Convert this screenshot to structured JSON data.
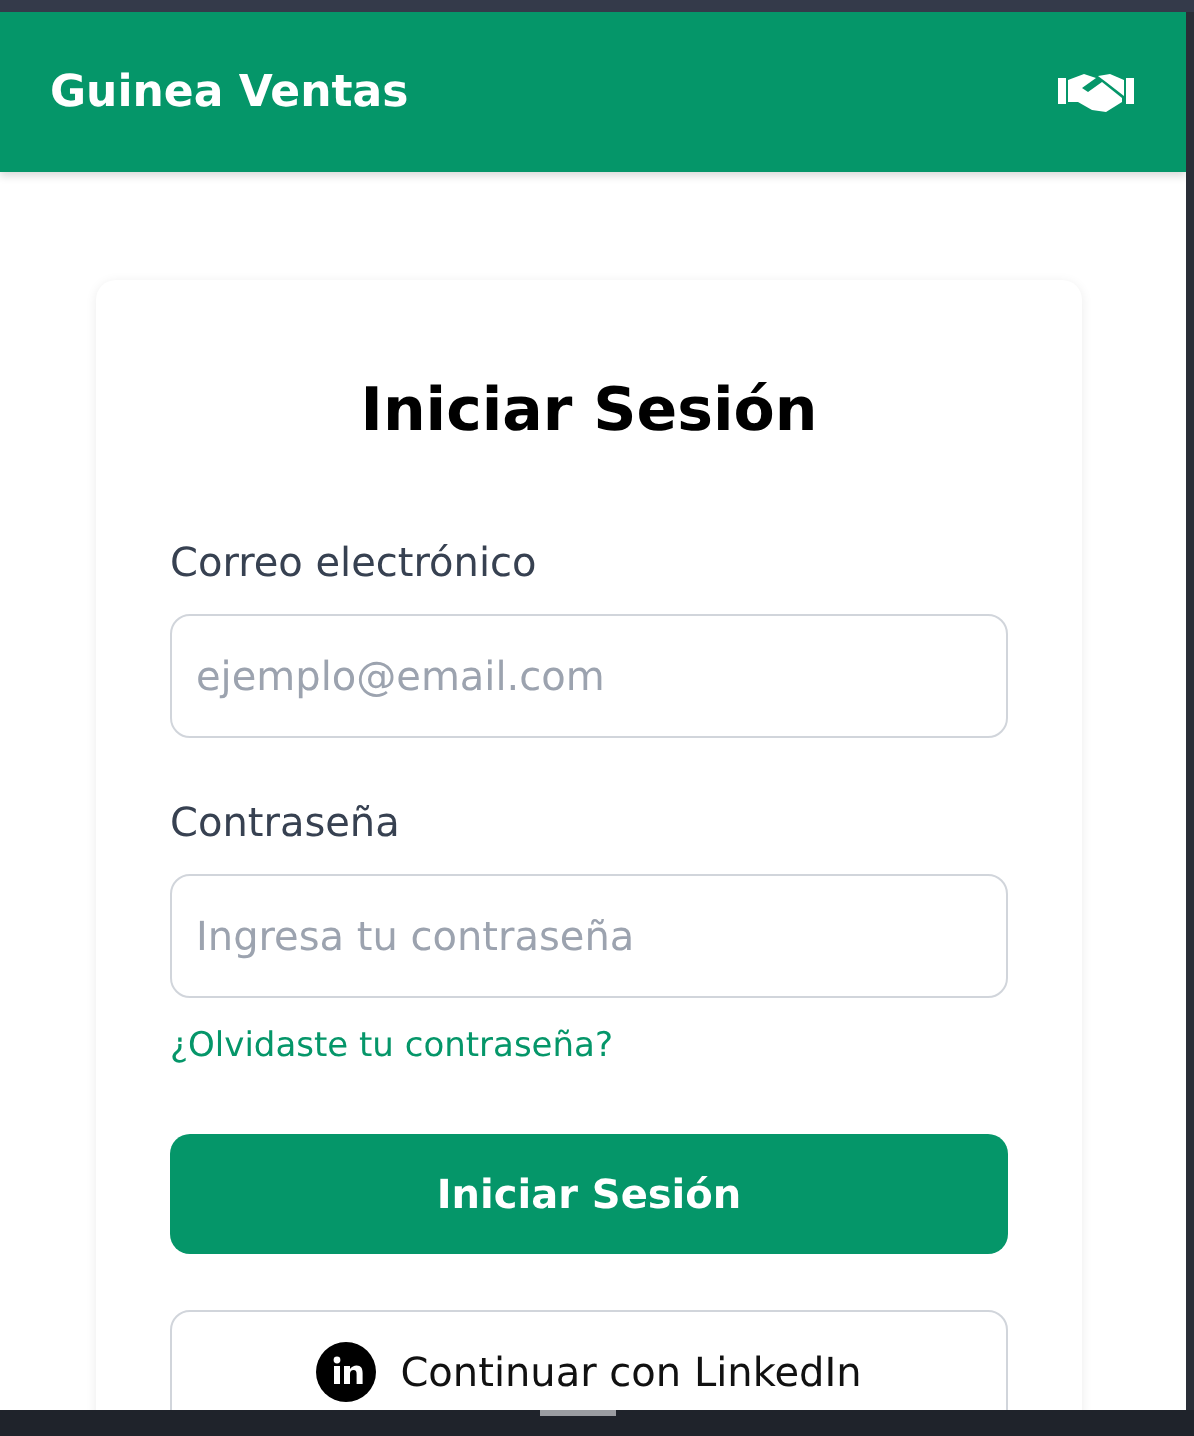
{
  "header": {
    "title": "Guinea Ventas"
  },
  "login": {
    "title": "Iniciar Sesión",
    "fields": [
      {
        "label": "Correo electrónico",
        "placeholder": "ejemplo@email.com"
      },
      {
        "label": "Contraseña",
        "placeholder": "Ingresa tu contraseña"
      }
    ],
    "forgot_link": "¿Olvidaste tu contraseña?",
    "submit_button": "Iniciar Sesión",
    "linkedin_button": "Continuar con LinkedIn"
  }
}
